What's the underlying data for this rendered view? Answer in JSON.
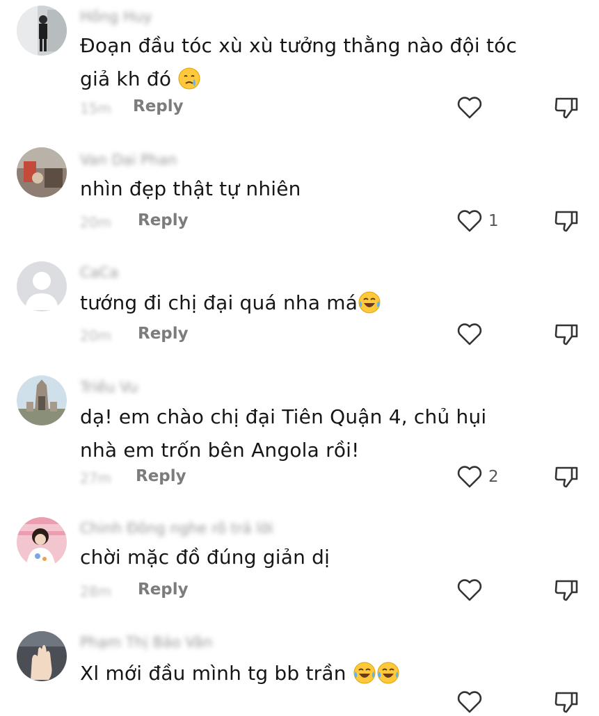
{
  "comments": [
    {
      "username": "Hồng Huy",
      "text": "Đoạn đầu tóc xù xù tưởng thằng nào đội tóc giả kh đó",
      "emoji": [
        "crying-face"
      ],
      "time": "15m",
      "reply_label": "Reply",
      "like_count": ""
    },
    {
      "username": "Van Dai Phan",
      "text": "nhìn đẹp thật tự nhiên",
      "emoji": [],
      "time": "20m",
      "reply_label": "Reply",
      "like_count": "1"
    },
    {
      "username": "CaCa",
      "text": "tướng đi chị đại quá nha má",
      "emoji": [
        "tears-of-joy"
      ],
      "time": "20m",
      "reply_label": "Reply",
      "like_count": ""
    },
    {
      "username": "Triều Vu",
      "text": "dạ! em chào chị đại Tiên Quận 4, chủ hụi nhà em trốn bên Angola rồi!",
      "emoji": [],
      "time": "27m",
      "reply_label": "Reply",
      "like_count": "2"
    },
    {
      "username": "Chinh Đông nghe rõ trả lời",
      "text": "chời mặc đồ đúng giản dị",
      "emoji": [],
      "time": "28m",
      "reply_label": "Reply",
      "like_count": ""
    },
    {
      "username": "Phạm Thị Bảo Vân",
      "text": "Xl mới đầu mình tg bb trần",
      "emoji": [
        "tears-of-joy",
        "tears-of-joy"
      ],
      "time": "",
      "reply_label": "",
      "like_count": ""
    }
  ],
  "icons": {
    "like": "heart-outline-icon",
    "dislike": "thumbs-down-icon"
  },
  "colors": {
    "text": "#161616",
    "meta": "#7c7c7c",
    "icon": "#333333",
    "emoji": "#FFC83D"
  }
}
